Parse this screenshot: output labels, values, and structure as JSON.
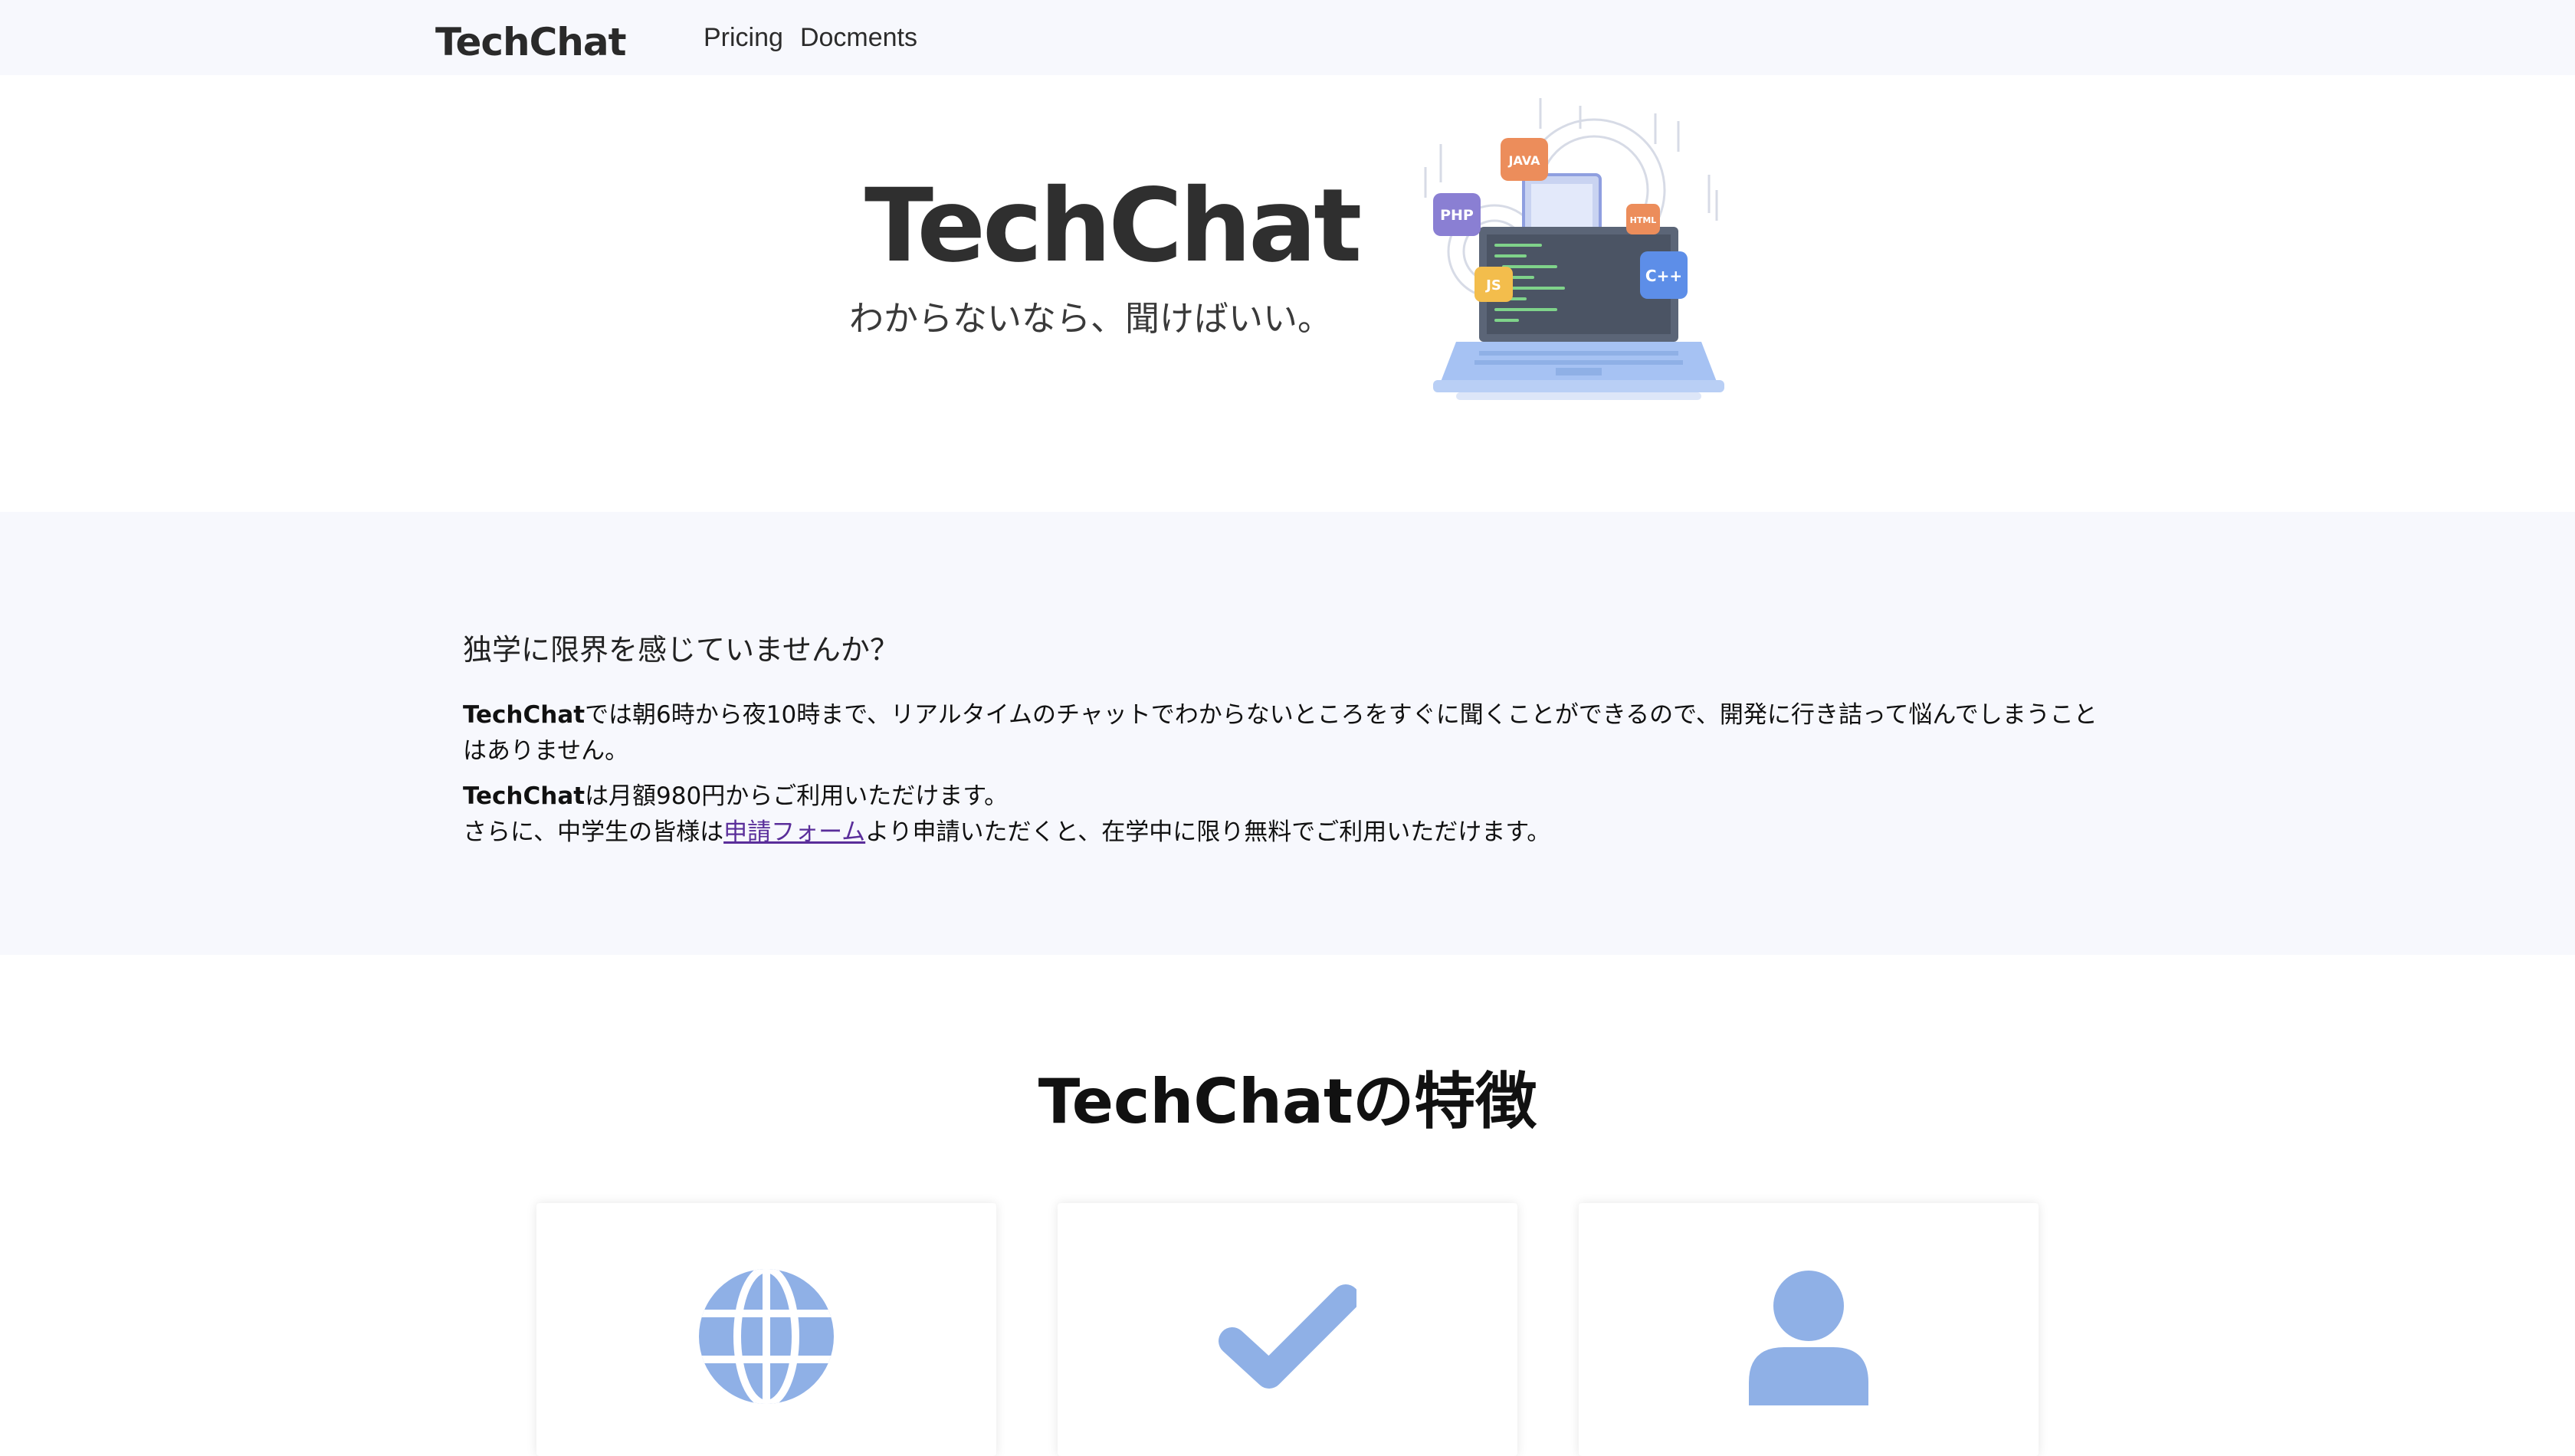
{
  "header": {
    "brand": "TechChat",
    "nav": [
      "Pricing",
      "Docments"
    ]
  },
  "hero": {
    "title": "TechChat",
    "subtitle": "わからないなら、聞けばいい。",
    "illustration_badges": [
      "JAVA",
      "PHP",
      "HTML",
      "JS",
      "C++"
    ]
  },
  "intro": {
    "question": "独学に限界を感じていませんか？",
    "p1_brand": "TechChat",
    "p1_text": "では朝6時から夜10時まで、リアルタイムのチャットでわからないところをすぐに聞くことができるので、開発に行き詰って悩んでしまうことはありません。",
    "p2_brand": "TechChat",
    "p2_text": "は月額980円からご利用いただけます。",
    "p2_line2_before": "さらに、中学生の皆様は",
    "p2_link": "申請フォーム",
    "p2_line2_after": "より申請いただくと、在学中に限り無料でご利用いただけます。"
  },
  "features": {
    "title": "TechChatの特徴",
    "cards": [
      {
        "icon": "globe-icon"
      },
      {
        "icon": "check-icon"
      },
      {
        "icon": "user-icon"
      }
    ]
  },
  "colors": {
    "band_bg": "#f7f8fd",
    "icon_blue": "#8fb0e6",
    "link_purple": "#5a2e9a",
    "text_dark": "#2f2f2f"
  }
}
